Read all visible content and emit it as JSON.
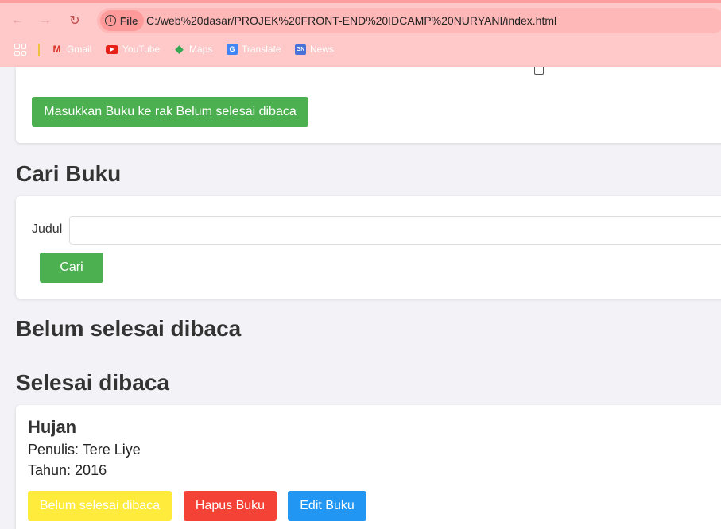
{
  "browser": {
    "url_scheme": "File",
    "url": "C:/web%20dasar/PROJEK%20FRONT-END%20IDCAMP%20NURYANI/index.html",
    "bookmarks": [
      {
        "label": "Gmail",
        "icon": "gmail-icon"
      },
      {
        "label": "YouTube",
        "icon": "youtube-icon"
      },
      {
        "label": "Maps",
        "icon": "maps-icon"
      },
      {
        "label": "Translate",
        "icon": "translate-icon"
      },
      {
        "label": "News",
        "icon": "news-icon"
      }
    ],
    "colors": {
      "toolbar": "#ffc9c9",
      "address_bar": "#ffb8b8"
    }
  },
  "add_form": {
    "submit_label": "Masukkan Buku ke rak Belum selesai dibaca"
  },
  "search": {
    "heading": "Cari Buku",
    "title_label": "Judul",
    "title_value": "",
    "button_label": "Cari"
  },
  "shelves": {
    "incomplete_heading": "Belum selesai dibaca",
    "complete_heading": "Selesai dibaca"
  },
  "books_complete": [
    {
      "title": "Hujan",
      "author": "Penulis: Tere Liye",
      "year": "Tahun: 2016",
      "move_label": "Belum selesai dibaca",
      "delete_label": "Hapus Buku",
      "edit_label": "Edit Buku"
    }
  ],
  "colors": {
    "green": "#4caf50",
    "yellow": "#ffeb3b",
    "red": "#f44336",
    "blue": "#2196f3"
  }
}
